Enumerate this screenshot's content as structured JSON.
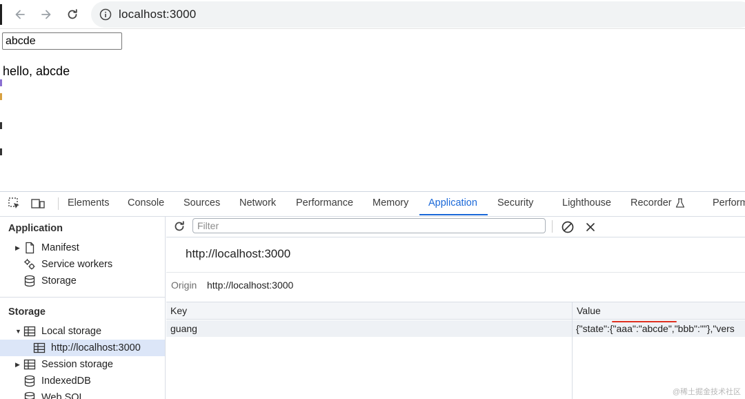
{
  "browser": {
    "url": "localhost:3000"
  },
  "page": {
    "input_value": "abcde",
    "hello_text": "hello, abcde"
  },
  "devtools": {
    "tabs": [
      "Elements",
      "Console",
      "Sources",
      "Network",
      "Performance",
      "Memory",
      "Application",
      "Security",
      "Lighthouse",
      "Recorder",
      "Perform"
    ],
    "active_tab": "Application",
    "sidebar": {
      "application_header": "Application",
      "application_items": [
        "Manifest",
        "Service workers",
        "Storage"
      ],
      "storage_header": "Storage",
      "storage_items": [
        "Local storage",
        "http://localhost:3000",
        "Session storage",
        "IndexedDB",
        "Web SQL"
      ]
    },
    "filter_placeholder": "Filter",
    "origin_title": "http://localhost:3000",
    "origin_label": "Origin",
    "origin_value": "http://localhost:3000",
    "table": {
      "headers": [
        "Key",
        "Value"
      ],
      "rows": [
        {
          "key": "guang",
          "value": "{\"state\":{\"aaa\":\"abcde\",\"bbb\":\"\"},\"vers"
        }
      ]
    },
    "watermark": "@稀土掘金技术社区"
  },
  "colors": {
    "accent": "#1a68d8",
    "selected": "#dce6f8",
    "underline": "#e03020"
  }
}
